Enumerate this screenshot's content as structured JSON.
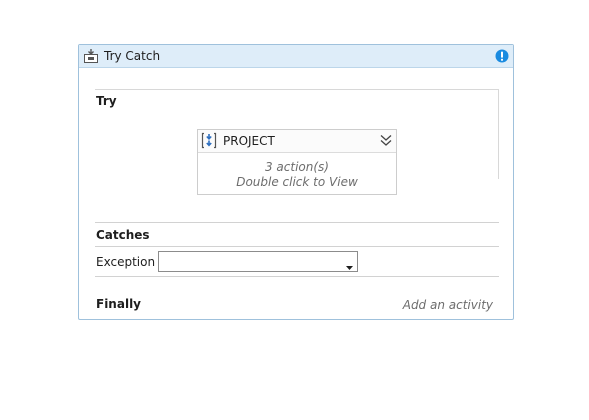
{
  "try_catch": {
    "title": "Try Catch",
    "icons": {
      "header": "try-catch-icon",
      "warning": "warning-icon",
      "sequence": "sequence-icon",
      "collapse": "collapse-chevron-icon",
      "dropdown": "dropdown-arrow-icon"
    },
    "try": {
      "label": "Try",
      "sequence": {
        "title": "PROJECT",
        "actions": "3 action(s)",
        "hint": "Double click to View"
      }
    },
    "catches": {
      "label": "Catches",
      "exception_label": "Exception",
      "exception_value": ""
    },
    "finally": {
      "label": "Finally",
      "placeholder": "Add an activity"
    }
  },
  "colors": {
    "header_bg": "#deedf9",
    "border": "#9fc1dc",
    "warning": "#1a8be0",
    "sequence_icon": "#2e6fc0"
  }
}
